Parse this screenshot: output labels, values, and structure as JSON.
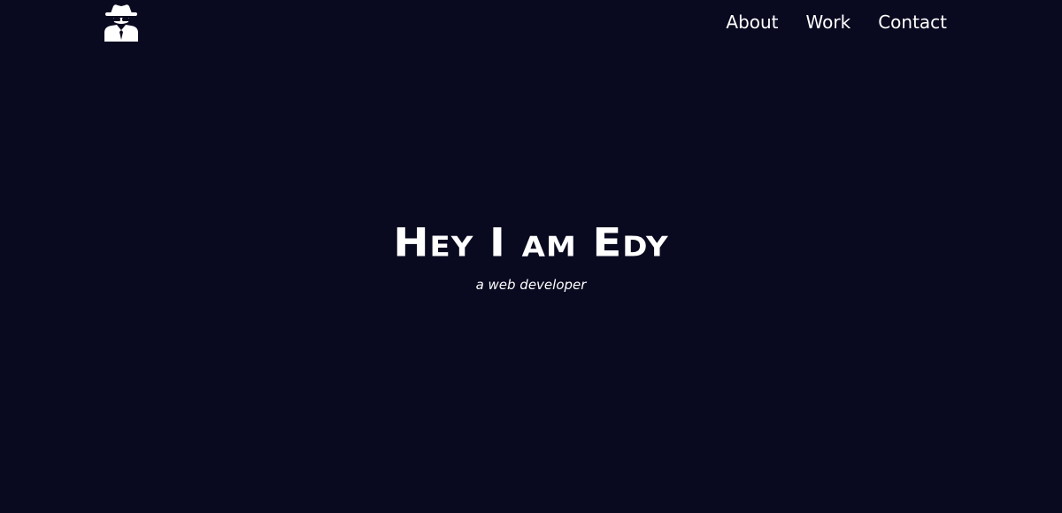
{
  "header": {
    "logo_icon": "spy-agent-icon",
    "nav": [
      {
        "label": "About"
      },
      {
        "label": "Work"
      },
      {
        "label": "Contact"
      }
    ]
  },
  "hero": {
    "title": "Hey I am Edy",
    "subtitle": "a web developer"
  },
  "colors": {
    "background": "#090920",
    "text": "#ffffff"
  }
}
